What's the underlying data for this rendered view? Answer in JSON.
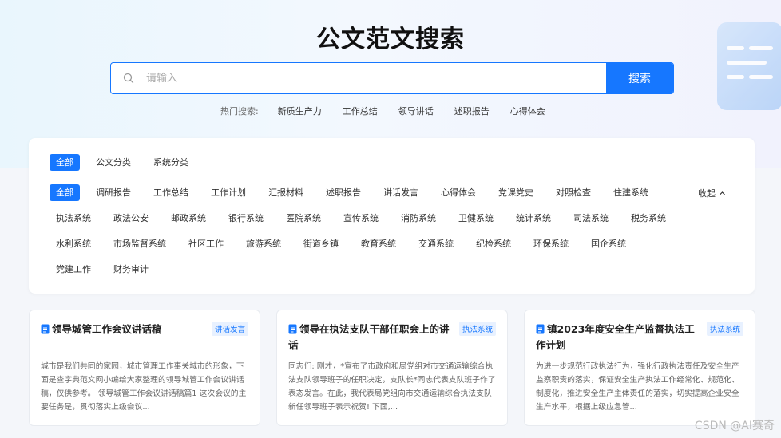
{
  "page_title": "公文范文搜索",
  "search": {
    "placeholder": "请输入",
    "button_label": "搜索",
    "hot_label": "热门搜索:",
    "hot_items": [
      "新质生产力",
      "工作总结",
      "领导讲话",
      "述职报告",
      "心得体会"
    ]
  },
  "filters": {
    "row1": [
      "全部",
      "公文分类",
      "系统分类"
    ],
    "row2": [
      "全部",
      "调研报告",
      "工作总结",
      "工作计划",
      "汇报材料",
      "述职报告",
      "讲话发言",
      "心得体会",
      "党课党史",
      "对照检查",
      "住建系统"
    ],
    "row3": [
      "执法系统",
      "政法公安",
      "邮政系统",
      "银行系统",
      "医院系统",
      "宣传系统",
      "消防系统",
      "卫健系统",
      "统计系统",
      "司法系统",
      "税务系统"
    ],
    "row4": [
      "水利系统",
      "市场监督系统",
      "社区工作",
      "旅游系统",
      "街道乡镇",
      "教育系统",
      "交通系统",
      "纪检系统",
      "环保系统",
      "国企系统"
    ],
    "row5": [
      "党建工作",
      "财务审计"
    ],
    "collapse_label": "收起"
  },
  "cards": [
    {
      "title": "领导城管工作会议讲话稿",
      "tag": "讲话发言",
      "body": "城市是我们共同的家园，城市管理工作事关城市的形象，下面是查字典范文网小编给大家整理的领导城管工作会议讲话稿，仅供参考。 领导城管工作会议讲话稿篇1 这次会议的主要任务是，贯彻落实上级会议..."
    },
    {
      "title": "领导在执法支队干部任职会上的讲话",
      "tag": "执法系统",
      "body": "同志们: 刚才，*宣布了市政府和局党组对市交通运输综合执法支队领导班子的任职决定，支队长*同志代表支队班子作了表态发言。在此，我代表局党组向市交通运输综合执法支队新任领导班子表示祝贺! 下面,..."
    },
    {
      "title": "镇2023年度安全生产监督执法工作计划",
      "tag": "执法系统",
      "body": "为进一步规范行政执法行为，强化行政执法责任及安全生产监察职责的落实，保证安全生产执法工作经常化、规范化、制度化，推进安全生产主体责任的落实，切实提高企业安全生产水平，根据上级应急管..."
    }
  ],
  "watermark": "CSDN @AI赛奇",
  "colors": {
    "accent": "#1677ff"
  }
}
